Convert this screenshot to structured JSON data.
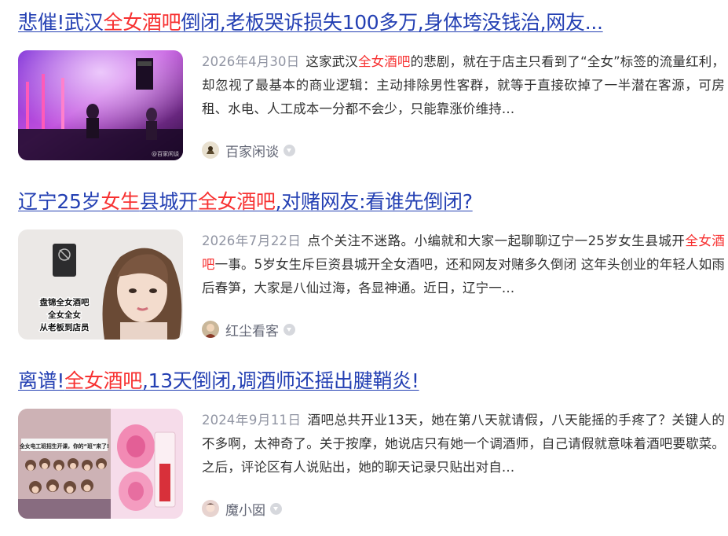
{
  "results": [
    {
      "title_parts": [
        {
          "text": "悲催!武汉",
          "highlight": false
        },
        {
          "text": "全女酒吧",
          "highlight": true
        },
        {
          "text": "倒闭,老板哭诉损失100多万,身体垮没钱治,网友...",
          "highlight": false
        }
      ],
      "date": "2026年4月30日",
      "abstract_parts": [
        {
          "text": "这家武汉",
          "highlight": false
        },
        {
          "text": "全女酒吧",
          "highlight": true
        },
        {
          "text": "的悲剧，就在于店主只看到了“全女”标签的流量红利，却忽视了最基本的商业逻辑：主动排除男性客群，就等于直接砍掉了一半潜在客源，可房租、水电、人工成本一分都不会少，只能靠涨价维持…",
          "highlight": false
        }
      ],
      "source": "百家闲谈",
      "thumb_watermark": "@百家闲谈"
    },
    {
      "title_parts": [
        {
          "text": "辽宁25岁",
          "highlight": false
        },
        {
          "text": "女生",
          "highlight": true
        },
        {
          "text": "县城开",
          "highlight": false
        },
        {
          "text": "全女酒吧",
          "highlight": true
        },
        {
          "text": ",对赌网友:看谁先倒闭?",
          "highlight": false
        }
      ],
      "date": "2026年7月22日",
      "abstract_parts": [
        {
          "text": "点个关注不迷路。小编就和大家一起聊聊辽宁一25岁女生县城开",
          "highlight": false
        },
        {
          "text": "全女酒吧",
          "highlight": true
        },
        {
          "text": "一事。5岁女生斥巨资县城开全女酒吧，还和网友对赌多久倒闭 这年头创业的年轻人如雨后春笋，大家是八仙过海，各显神通。近日，辽宁一…",
          "highlight": false
        }
      ],
      "source": "红尘看客",
      "thumb_caption": [
        "盘锦全女酒吧",
        "全女全女",
        "从老板到店员"
      ]
    },
    {
      "title_parts": [
        {
          "text": "离谱!",
          "highlight": false
        },
        {
          "text": "全女酒吧",
          "highlight": true
        },
        {
          "text": ",13天倒闭,调酒师还摇出腱鞘炎!",
          "highlight": false
        }
      ],
      "date": "2024年9月11日",
      "abstract_parts": [
        {
          "text": "酒吧总共开业13天，她在第八天就请假，八天能摇的手疼了？关键人的不多啊，太神奇了。关于按摩，她说店只有她一个调酒师，自己请假就意味着酒吧要歇菜。之后，评论区有人说贴出，她的聊天记录只贴出对自…",
          "highlight": false
        }
      ],
      "source": "魔小囡",
      "thumb_banner": "全女电工班招生开课，你的“班”来了!"
    }
  ],
  "colors": {
    "title_link": "#2440b3",
    "highlight": "#f73131",
    "date": "#9195a3",
    "body_text": "#333333",
    "source_text": "#626675"
  },
  "icons": {
    "verify": "chevron-down-circle-icon"
  }
}
